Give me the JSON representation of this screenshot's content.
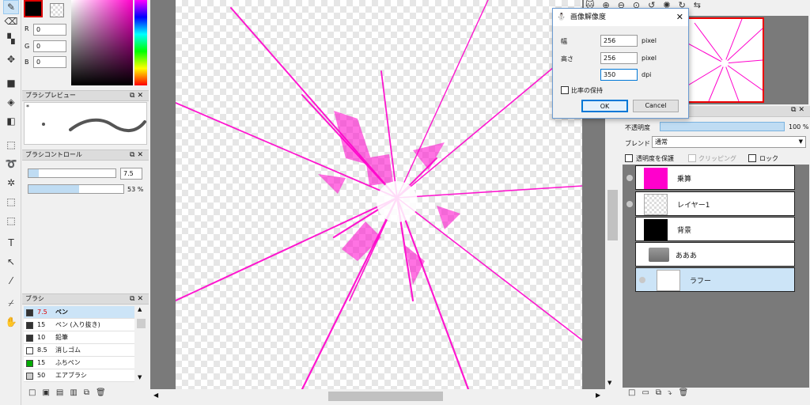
{
  "color_panel": {
    "r_label": "R",
    "g_label": "G",
    "b_label": "B",
    "r": "0",
    "g": "0",
    "b": "0"
  },
  "brush_preview": {
    "title": "ブラシプレビュー",
    "star": "*"
  },
  "brush_control": {
    "title": "ブラシコントロール",
    "size": "7.5",
    "opacity": "53 %",
    "size_fraction": 0.12,
    "opacity_fraction": 0.53
  },
  "brush_list": {
    "title": "ブラシ",
    "items": [
      {
        "size": "7.5",
        "name": "ペン",
        "color": "#333333"
      },
      {
        "size": "15",
        "name": "ペン (入り抜き)",
        "color": "#333333"
      },
      {
        "size": "10",
        "name": "鉛筆",
        "color": "#333333"
      },
      {
        "size": "8.5",
        "name": "消しゴム",
        "color": "#ffffff"
      },
      {
        "size": "15",
        "name": "ふちペン",
        "color": "#00aa00"
      },
      {
        "size": "50",
        "name": "エアブラシ",
        "color": "#cccccc"
      }
    ]
  },
  "dialog": {
    "title": "画像解像度",
    "width_label": "幅",
    "width_value": "256",
    "width_unit": "pixel",
    "height_label": "高さ",
    "height_value": "256",
    "height_unit": "pixel",
    "dpi_value": "350",
    "dpi_unit": "dpi",
    "keep_ratio_label": "比率の保持",
    "ok_label": "OK",
    "cancel_label": "Cancel"
  },
  "layer_panel": {
    "opacity_label": "不透明度",
    "opacity_value": "100 %",
    "blend_label": "ブレンド",
    "blend_value": "通常",
    "protect_label": "透明度を保護",
    "clip_label": "クリッピング",
    "lock_label": "ロック",
    "layers": [
      {
        "name": "乗算",
        "thumb": "#ff00cc"
      },
      {
        "name": "レイヤー1",
        "thumb": "checker"
      },
      {
        "name": "背景",
        "thumb": "#000000"
      },
      {
        "name": "あああ",
        "thumb": "folder"
      },
      {
        "name": "ラフー",
        "thumb": "sketch"
      }
    ]
  },
  "colors": {
    "accent": "#ff00cc",
    "selection": "#cce4f7",
    "dialog_border": "#6b9bd1"
  }
}
